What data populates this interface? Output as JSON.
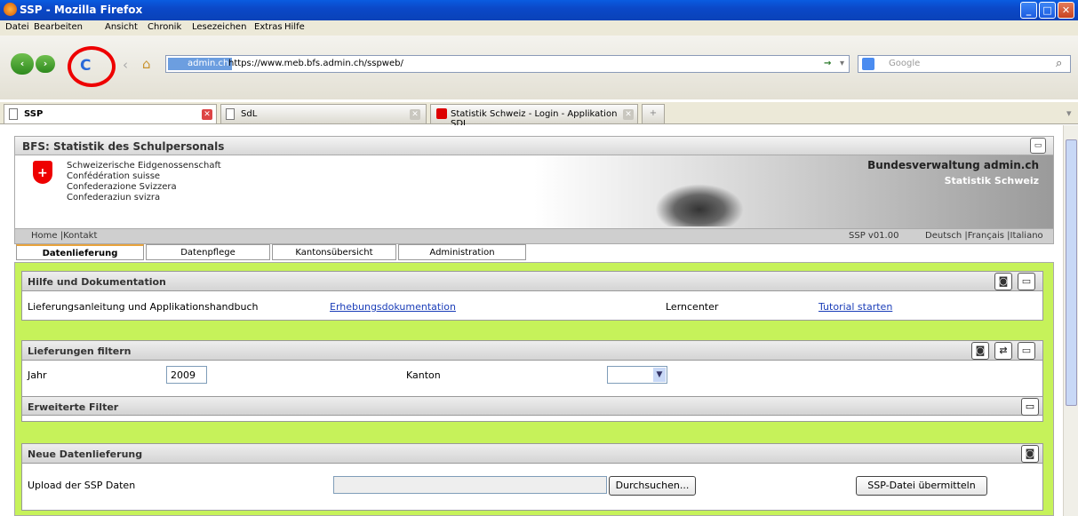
{
  "window": {
    "title": "SSP - Mozilla Firefox"
  },
  "menu": [
    "Datei",
    "Bearbeiten",
    "Ansicht",
    "Chronik",
    "Lesezeichen",
    "Extras",
    "Hilfe"
  ],
  "nav": {
    "domain": "admin.ch",
    "url": "https://www.meb.bfs.admin.ch/sspweb/",
    "search_placeholder": "Google"
  },
  "browser_tabs": [
    {
      "label": "SSP"
    },
    {
      "label": "SdL"
    },
    {
      "label": "Statistik Schweiz - Login - Applikation SDL"
    }
  ],
  "app": {
    "title": "BFS: Statistik des Schulpersonals",
    "confed": [
      "Schweizerische Eidgenossenschaft",
      "Confédération suisse",
      "Confederazione Svizzera",
      "Confederaziun svizra"
    ],
    "brand": "Bundesverwaltung admin.ch",
    "brand_sub": "Statistik Schweiz",
    "home": "Home",
    "kontakt": "Kontakt",
    "version": "SSP v01.00",
    "lang_de": "Deutsch",
    "lang_fr": "Français",
    "lang_it": "Italiano",
    "tabs": [
      "Datenlieferung",
      "Datenpflege",
      "Kantonsübersicht",
      "Administration"
    ],
    "hilfe": {
      "title": "Hilfe und Dokumentation",
      "anleitung": "Lieferungsanleitung und Applikationshandbuch",
      "erhebung": "Erhebungsdokumentation",
      "lerncenter": "Lerncenter",
      "tutorial": "Tutorial starten"
    },
    "filter": {
      "title": "Lieferungen filtern",
      "jahr_label": "Jahr",
      "jahr_value": "2009",
      "kanton_label": "Kanton",
      "erweitert": "Erweiterte Filter"
    },
    "neu": {
      "title": "Neue Datenlieferung",
      "upload_label": "Upload der SSP Daten",
      "browse": "Durchsuchen...",
      "submit": "SSP-Datei übermitteln"
    }
  }
}
